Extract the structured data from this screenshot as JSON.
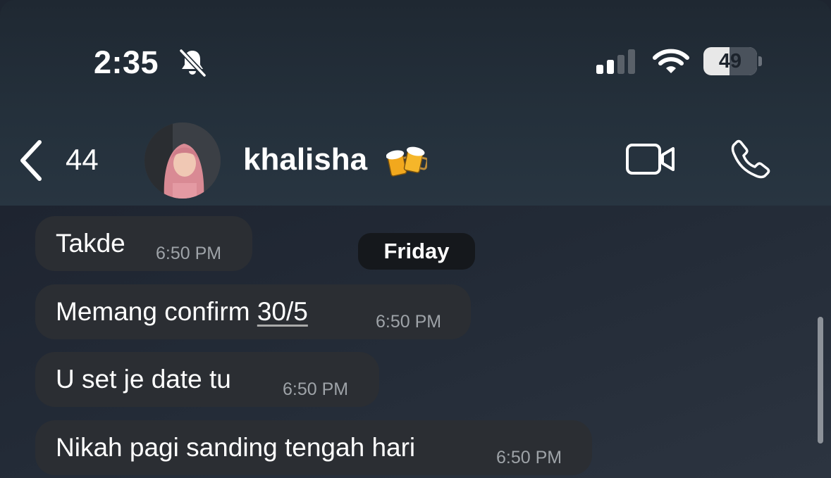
{
  "status_bar": {
    "time": "2:35",
    "battery_percent": "49",
    "battery_level": 0.49,
    "icons": [
      "bell-slash-icon",
      "cellular-signal-icon",
      "wifi-icon",
      "battery-icon"
    ]
  },
  "header": {
    "back_count": "44",
    "contact_name": "khalisha",
    "name_emoji": "beer-mugs-icon",
    "actions": [
      "video-call-icon",
      "phone-icon"
    ]
  },
  "chat": {
    "date_label": "Friday",
    "messages": [
      {
        "text": "Takde",
        "time": "6:50 PM"
      },
      {
        "text_prefix": "Memang confirm ",
        "link": "30/5",
        "time": "6:50 PM"
      },
      {
        "text": "U set je date tu",
        "time": "6:50 PM"
      },
      {
        "text": "Nikah pagi sanding tengah hari",
        "time": "6:50 PM"
      }
    ]
  },
  "colors": {
    "bubble": "#2b2e33",
    "header_bg": "#24303b",
    "timestamp": "#9ea3a8"
  }
}
